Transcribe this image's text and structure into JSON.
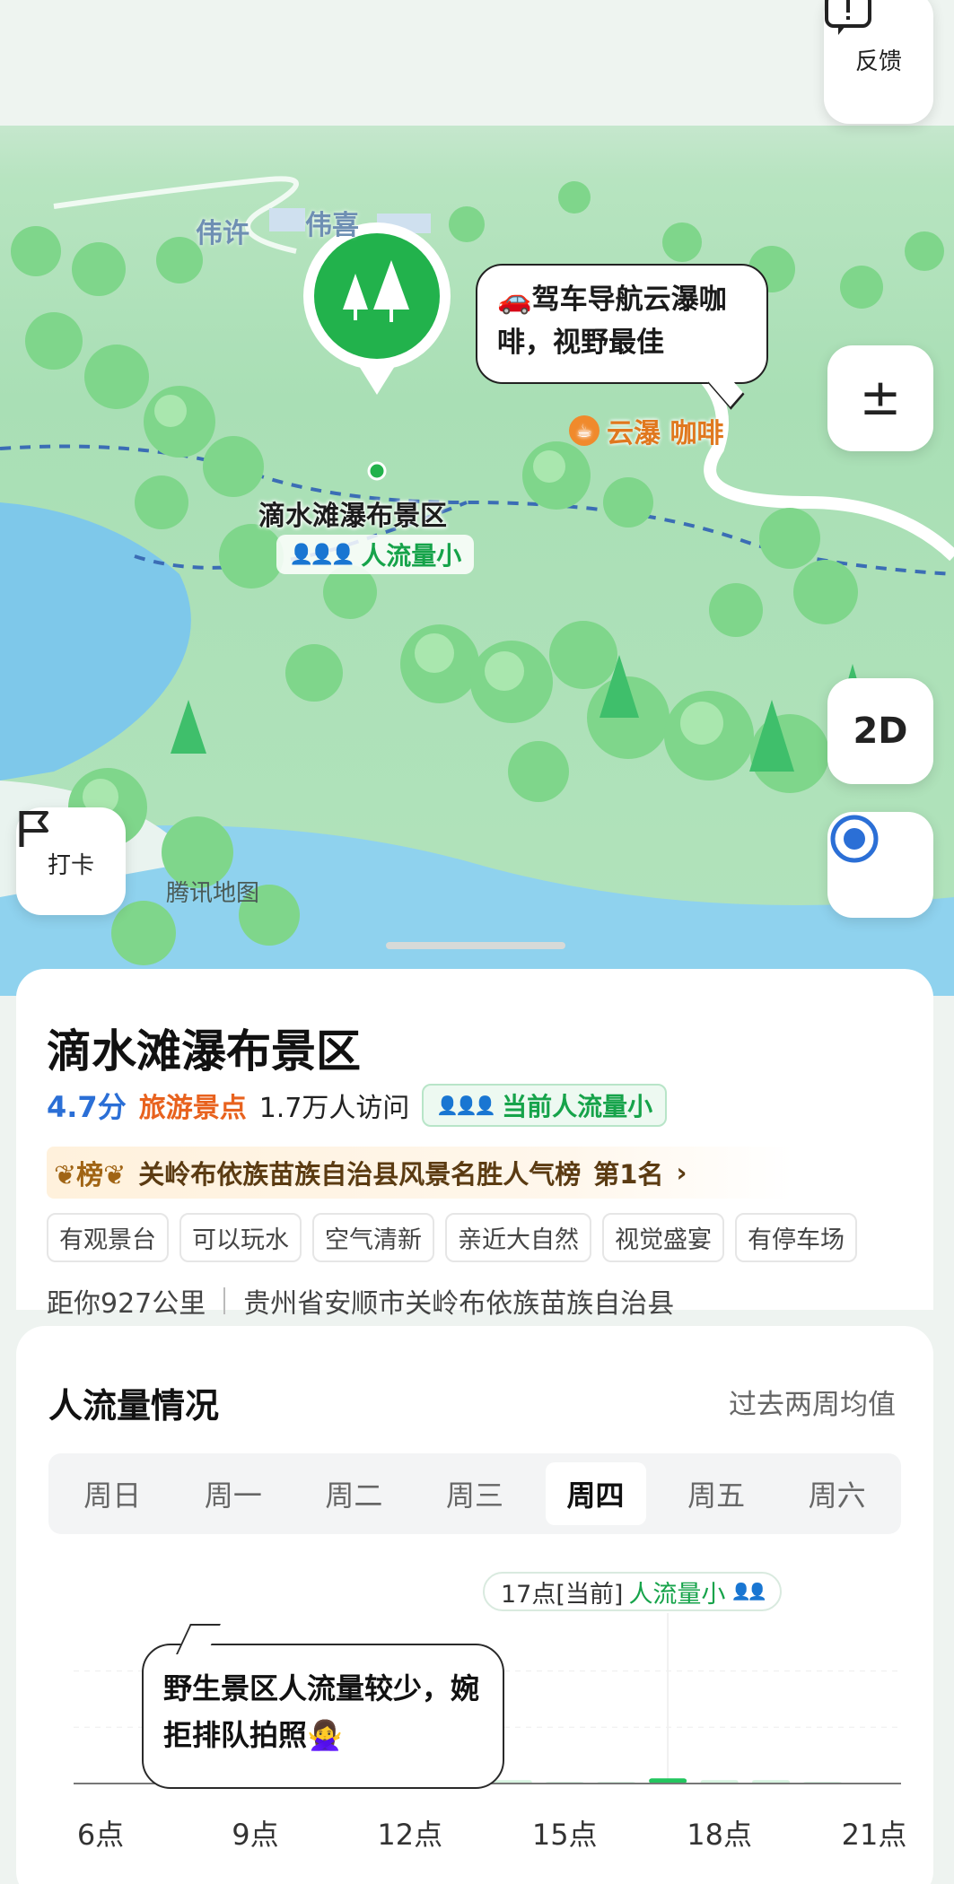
{
  "map": {
    "feedback_label": "反馈",
    "zoom_label": "±",
    "mode_label": "2D",
    "checkin_label": "打卡",
    "watermark": "腾讯地图",
    "villages": [
      "伟许",
      "伟喜"
    ],
    "poi_name": "滴水滩瀑布景区",
    "poi_crowd": "人流量小",
    "bubble_text": "🚗驾车导航云瀑咖啡，视野最佳",
    "cafe_name": "云瀑 咖啡"
  },
  "info": {
    "name": "滴水滩瀑布景区",
    "score": "4.7分",
    "category": "旅游景点",
    "visits": "1.7万人访问",
    "crowd_now": "当前人流量小",
    "rank_badge": "榜",
    "rank_text": "关岭布依族苗族自治县风景名胜人气榜",
    "rank_pos": "第1名",
    "tags": [
      "有观景台",
      "可以玩水",
      "空气清新",
      "亲近大自然",
      "视觉盛宴",
      "有停车场"
    ],
    "distance": "距你927公里",
    "address": "贵州省安顺市关岭布依族苗族自治县"
  },
  "crowd": {
    "title": "人流量情况",
    "subtitle": "过去两周均值",
    "days": [
      "周日",
      "周一",
      "周二",
      "周三",
      "周四",
      "周五",
      "周六"
    ],
    "tooltip_time": "17点[当前]",
    "tooltip_level": "人流量小",
    "bubble_text": "野生景区人流量较少，婉拒排队拍照🙅‍♀️"
  },
  "colors": {
    "green": "#16a34a",
    "orange": "#e8621e",
    "blue": "#2b6fd6"
  },
  "chart_data": {
    "type": "bar",
    "x": [
      6,
      7,
      8,
      9,
      10,
      11,
      12,
      13,
      14,
      15,
      16,
      17,
      18,
      19,
      20,
      21
    ],
    "x_tick_labels": [
      "6点",
      "9点",
      "12点",
      "15点",
      "18点",
      "21点"
    ],
    "x_tick_values": [
      6,
      9,
      12,
      15,
      18,
      21
    ],
    "values": [
      0,
      0,
      0,
      1,
      1,
      2,
      2,
      2,
      2,
      1,
      1,
      3,
      2,
      2,
      1,
      0
    ],
    "highlight_x": 17,
    "ylim": [
      0,
      100
    ],
    "grid": true
  }
}
